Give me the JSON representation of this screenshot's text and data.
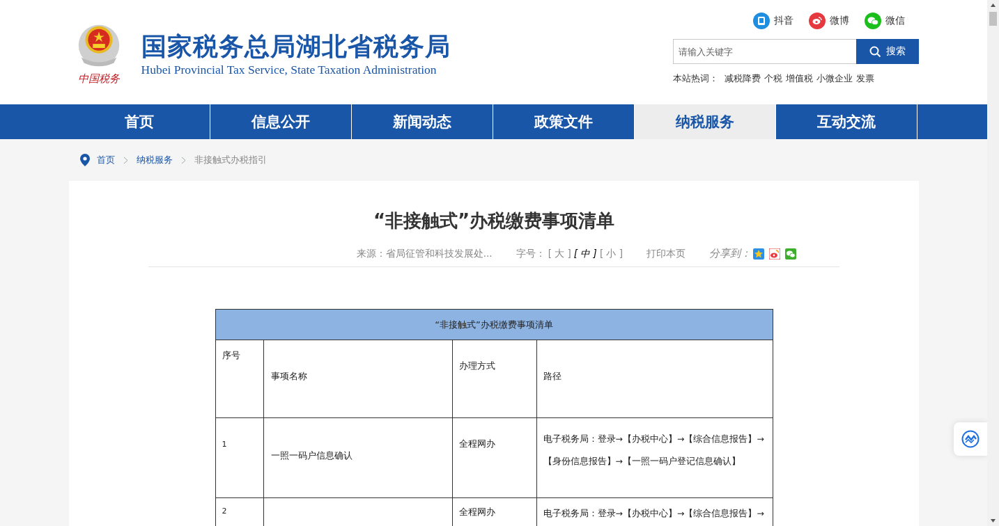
{
  "header": {
    "title": "国家税务总局湖北省税务局",
    "subtitle": "Hubei Provincial Tax Service, State Taxation Administration",
    "logo_caption": "中国税务",
    "social": [
      {
        "kind": "douyin",
        "label": "抖音"
      },
      {
        "kind": "weibo",
        "label": "微博"
      },
      {
        "kind": "wechat",
        "label": "微信"
      }
    ],
    "search": {
      "placeholder": "请输入关键字",
      "button": "搜索"
    },
    "hot_label": "本站热词：",
    "hot_words": [
      "减税降费",
      "个税",
      "增值税",
      "小微企业",
      "发票"
    ]
  },
  "nav": [
    {
      "label": "首页",
      "selected": false
    },
    {
      "label": "信息公开",
      "selected": false
    },
    {
      "label": "新闻动态",
      "selected": false
    },
    {
      "label": "政策文件",
      "selected": false
    },
    {
      "label": "纳税服务",
      "selected": true
    },
    {
      "label": "互动交流",
      "selected": false
    }
  ],
  "breadcrumb": [
    {
      "label": "首页",
      "current": false
    },
    {
      "label": "纳税服务",
      "current": false
    },
    {
      "label": "非接触式办税指引",
      "current": true
    }
  ],
  "article": {
    "title": "“非接触式”办税缴费事项清单",
    "source": "来源：省局征管和科技发展处...",
    "font_size_label": "字号：",
    "font_sizes": [
      {
        "label": "[ 大 ]",
        "selected": false
      },
      {
        "label": "[ 中 ]",
        "selected": true
      },
      {
        "label": "[ 小 ]",
        "selected": false
      }
    ],
    "print": "打印本页",
    "share_label": "分享到：",
    "share": [
      {
        "kind": "qzone"
      },
      {
        "kind": "weibo"
      },
      {
        "kind": "wechat"
      }
    ]
  },
  "table": {
    "caption": "“非接触式”办税缴费事项清单",
    "columns": [
      "序号",
      "事项名称",
      "办理方式",
      "路径"
    ],
    "rows": [
      {
        "cells": [
          "1",
          "一照一码户信息确认",
          "全程网办"
        ],
        "path": [
          "电子税务局：登录→【办税中心】→【综合信息报告】→",
          "【身份信息报告】→【一照一码户登记信息确认】"
        ]
      },
      {
        "cells": [
          "2",
          "",
          "全程网办"
        ],
        "path": [
          "电子税务局：登录→【办税中心】→【综合信息报告】→"
        ]
      }
    ]
  }
}
